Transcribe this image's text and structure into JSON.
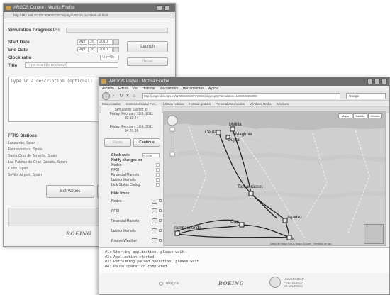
{
  "back_window": {
    "title": "ARGOS Control - Mozilla Firefox",
    "url": "http://192.168.10.102:8080/ECSCfs/jetty/ARGOS.jsp?start=all.html",
    "progress_label": "Simulation Progress:",
    "progress_value": "0%",
    "progress_fraction": 0,
    "start_date_label": "Start Date",
    "start_date": {
      "month": "Apr",
      "day": "26",
      "year": "2010"
    },
    "end_date_label": "End Date",
    "end_date": {
      "month": "Apr",
      "day": "26",
      "year": "2010"
    },
    "clock_ratio_label": "Clock ratio",
    "clock_ratio_value": "½ r=0k",
    "title_label": "Title",
    "title_placeholder": "Type in a title (optional)",
    "launch_button": "Launch",
    "reset_button": "Reset",
    "description_placeholder": "Type in a description (optional)",
    "stations_heading": "FFRS Stations",
    "stations": [
      "Lanzarote, Spain",
      "Fuerteventura, Spain",
      "Santa Cruz de Tenerife, Spain",
      "Las Palmas de Gran Canaria, Spain",
      "Cadiz, Spain",
      "Sevilla Airport, Spain"
    ],
    "set_values_button": "Set Values",
    "logo": "BOEING"
  },
  "front_window": {
    "title": "ARGOS Player - Mozilla Firefox",
    "menu": [
      "Archivo",
      "Editar",
      "Ver",
      "Historial",
      "Marcadores",
      "Herramientas",
      "Ayuda"
    ],
    "url": "http://jungle.dsic.upv.es/WEBSCOCS/ARGOS/player.php?simulation=1298915494000",
    "search_placeholder": "Google",
    "bookmarks": [
      "Más visitados",
      "Comenzar a usar Fire...",
      "Últimas noticias",
      "Hotmail gratuito",
      "Personalizar vínculos",
      "Windows Media",
      "Windows"
    ],
    "tab": "ARGOS Player",
    "sim_started_line1": "Simulation Started at:",
    "sim_started_line2": "Friday, February 18th, 2011",
    "sim_started_line3": "03:13:24",
    "current_line1": "Friday, February 18th, 2011",
    "current_line2": "04:27:36",
    "pause_button": "Pause",
    "continue_button": "Continue",
    "clock_ratio_label": "Clock ratio",
    "clock_ratio_value": "½ r=0k",
    "notify_label": "Notify changes on",
    "notify_items": [
      "Nodes",
      "PFSI",
      "Financial Markets",
      "Labour Markets",
      "Link Status Dialog"
    ],
    "hide_icons_label": "Hide Icons:",
    "icon_items": [
      "Nodes",
      "PFSI",
      "Financial Markets",
      "Labour Markets",
      "Routes Weather"
    ],
    "map_buttons": [
      "Mapa",
      "Satélite",
      "Híbrido"
    ],
    "cities": [
      "Ceuta",
      "Melilla",
      "Oujda",
      "Maghnia",
      "Tamanrasset",
      "Agadez",
      "Gao",
      "Tambacounda",
      "K"
    ],
    "map_copyright": "Datos de mapa ©2011 Mapa GISrael · Términos de uso",
    "console_lines": [
      "#1: Starting application, please wait",
      "#2: Application started",
      "#3: Performing paused operation, please wait",
      "#4: Pause operation completed"
    ],
    "footer_integra": "integra",
    "footer_logo": "BOEING",
    "footer_uni_line1": "UNIVERSIDAD",
    "footer_uni_line2": "POLITECNICA",
    "footer_uni_line3": "DE VALENCIA"
  }
}
